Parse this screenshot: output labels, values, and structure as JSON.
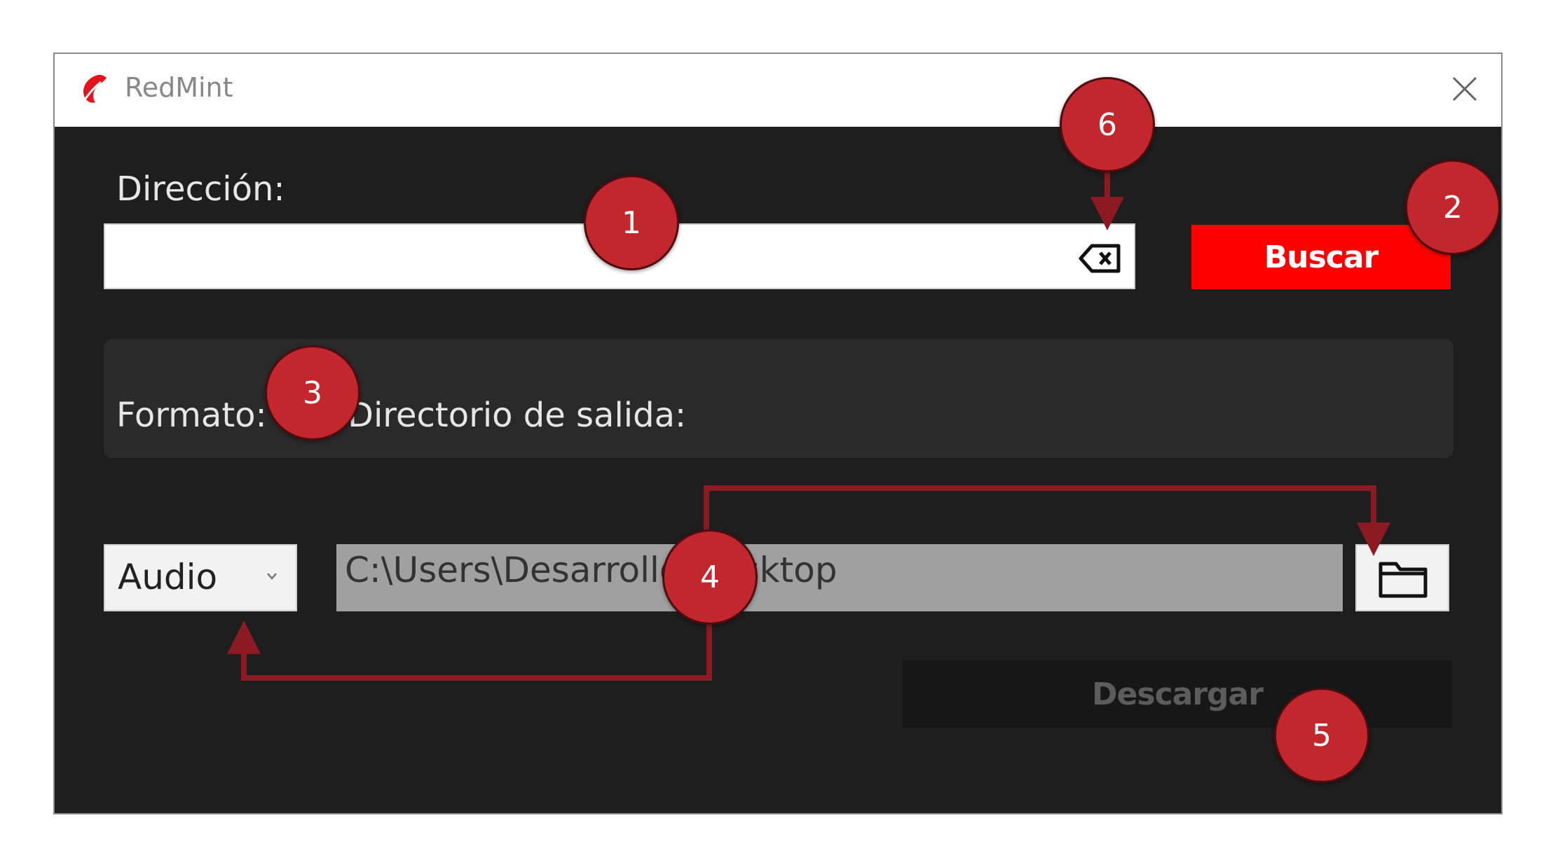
{
  "window": {
    "title": "RedMint",
    "app_icon": "redmint-logo-icon",
    "close_icon": "close-icon"
  },
  "url_section": {
    "label": "Dirección:",
    "value": "",
    "clear_icon": "backspace-clear-icon",
    "search_button": "Buscar",
    "search_button_color": "#ff0000"
  },
  "results_panel": {},
  "format_section": {
    "label": "Formato:",
    "selected": "Audio",
    "dropdown_icon": "chevron-down-icon"
  },
  "output_section": {
    "label": "Directorio de salida:",
    "path": "C:\\Users\\Desarrollo\\Desktop",
    "folder_icon": "folder-icon"
  },
  "download_button": {
    "label": "Descargar",
    "enabled": false
  },
  "annotations": {
    "badges": [
      "1",
      "2",
      "3",
      "4",
      "5",
      "6"
    ],
    "badge_color": "#c3272e",
    "arrow_color": "#8b1a22"
  }
}
